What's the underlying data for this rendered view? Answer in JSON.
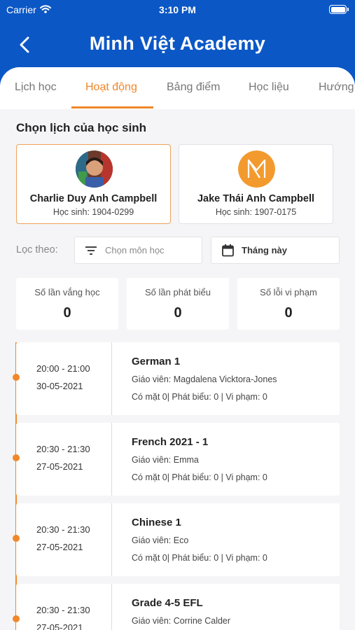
{
  "status_bar": {
    "carrier": "Carrier",
    "time": "3:10 PM"
  },
  "header": {
    "title": "Minh Việt Academy"
  },
  "tabs": [
    {
      "label": "Lịch học",
      "active": false
    },
    {
      "label": "Hoạt động",
      "active": true
    },
    {
      "label": "Bảng điểm",
      "active": false
    },
    {
      "label": "Học liệu",
      "active": false
    },
    {
      "label": "Hướng",
      "active": false
    }
  ],
  "student_section": {
    "title": "Chọn lịch của học sinh",
    "students": [
      {
        "name": "Charlie Duy Anh Campbell",
        "id": "Học sinh: 1904-0299",
        "selected": true
      },
      {
        "name": "Jake Thái Anh Campbell",
        "id": "Học sinh: 1907-0175",
        "selected": false
      }
    ]
  },
  "filter": {
    "label": "Lọc theo:",
    "subject_placeholder": "Chọn môn học",
    "period": "Tháng này"
  },
  "stats": [
    {
      "label": "Số lần vắng học",
      "value": "0"
    },
    {
      "label": "Số lần phát biểu",
      "value": "0"
    },
    {
      "label": "Số lỗi vi phạm",
      "value": "0"
    }
  ],
  "activities": [
    {
      "time": "20:00 - 21:00",
      "date": "30-05-2021",
      "subject": "German 1",
      "teacher": "Giáo viên: Magdalena Vicktora-Jones",
      "stats": "Có mặt 0| Phát biểu: 0 | Vi phạm: 0"
    },
    {
      "time": "20:30 - 21:30",
      "date": "27-05-2021",
      "subject": "French 2021 - 1",
      "teacher": "Giáo viên: Emma",
      "stats": "Có mặt 0| Phát biểu: 0 | Vi phạm: 0"
    },
    {
      "time": "20:30 - 21:30",
      "date": "27-05-2021",
      "subject": "Chinese 1",
      "teacher": "Giáo viên: Eco",
      "stats": "Có mặt 0| Phát biểu: 0 | Vi phạm: 0"
    },
    {
      "time": "20:30 - 21:30",
      "date": "27-05-2021",
      "subject": "Grade 4-5 EFL",
      "teacher": "Giáo viên: Corrine Calder",
      "stats": ""
    }
  ],
  "colors": {
    "primary": "#0b57c6",
    "accent": "#f0872a",
    "background": "#f5f5f7"
  },
  "icons": [
    "wifi-icon",
    "battery-icon",
    "back-chevron-icon",
    "filter-icon",
    "calendar-icon"
  ]
}
